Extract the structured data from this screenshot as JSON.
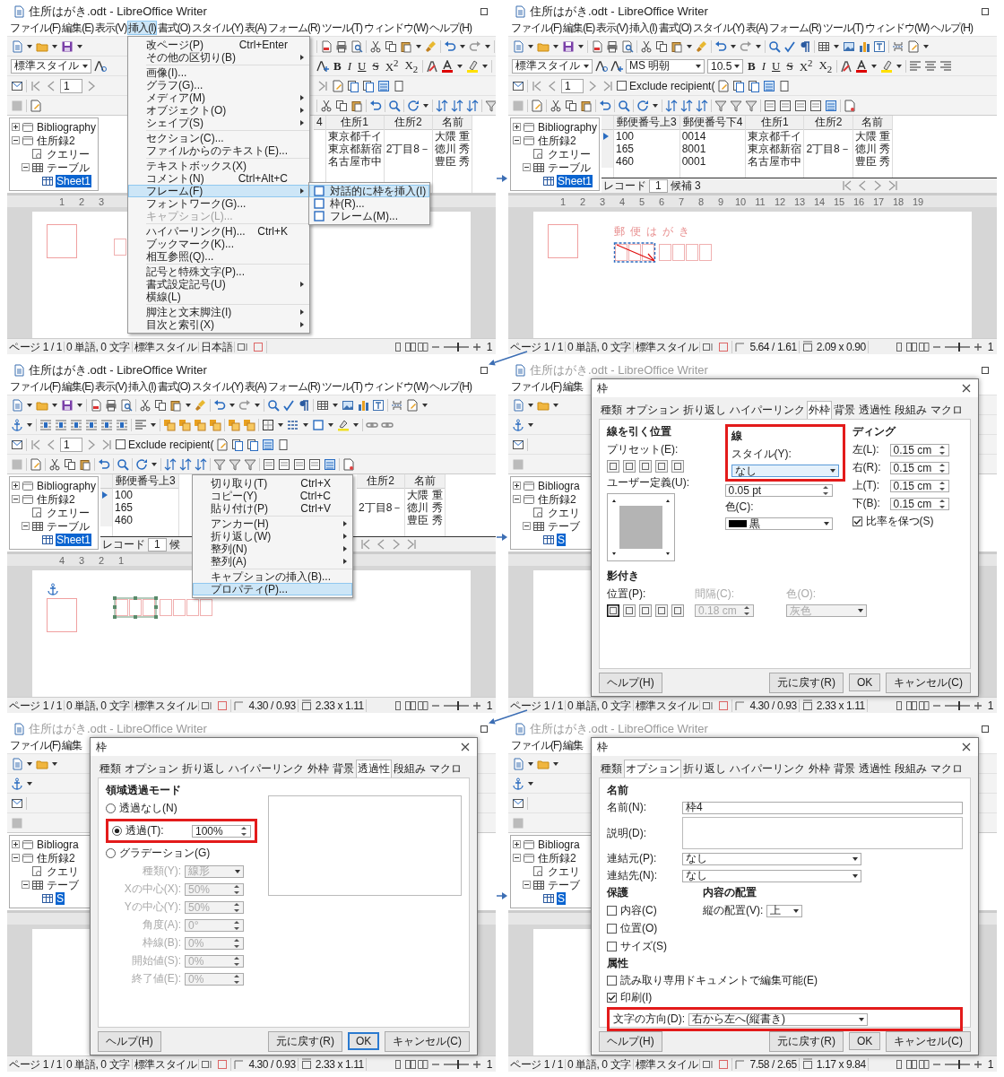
{
  "panels": [
    {
      "title": "住所はがき.odt - LibreOffice Writer",
      "active": true,
      "menu": [
        {
          "label": "ファイル(F)",
          "selected": false
        },
        {
          "label": "編集(E)",
          "selected": false
        },
        {
          "label": "表示(V)",
          "selected": false
        },
        {
          "label": "挿入(I)",
          "selected": true
        },
        {
          "label": "書式(O)",
          "selected": false
        },
        {
          "label": "スタイル(Y)",
          "selected": false
        },
        {
          "label": "表(A)",
          "selected": false
        },
        {
          "label": "フォーム(R)",
          "selected": false
        },
        {
          "label": "ツール(T)",
          "selected": false
        },
        {
          "label": "ウィンドウ(W)",
          "selected": false
        },
        {
          "label": "ヘルプ(H)",
          "selected": false
        }
      ],
      "toolbar": {
        "kind": "text"
      },
      "style_box": "標準スタイル",
      "format_buttons": [
        {
          "label": "B",
          "kind": "bold"
        },
        {
          "label": "I",
          "kind": "italic"
        },
        {
          "label": "U",
          "kind": "underline"
        },
        {
          "label": "S",
          "kind": "strike"
        },
        {
          "label": "X$^{2}$",
          "kind": "plain"
        },
        {
          "label": "X$_{2}$",
          "kind": "plain"
        }
      ],
      "page_field": "1",
      "tree": [
        {
          "label": "Bibliography",
          "kind": "database",
          "expanded": false,
          "selected": false
        },
        {
          "label": "住所録2",
          "kind": "database",
          "expanded": true,
          "selected": false,
          "children": [
            {
              "label": "クエリー",
              "kind": "queries",
              "selected": false
            },
            {
              "label": "テーブル",
              "kind": "tables",
              "expanded": true,
              "selected": false,
              "children": [
                {
                  "label": "Sheet1",
                  "kind": "table",
                  "selected": true
                }
              ]
            }
          ]
        }
      ],
      "table": {
        "columns": [
          "4",
          "住所1",
          "住所2",
          "名前"
        ],
        "rows": [
          {
            "cells": [
              null,
              "東京都千イ",
              null,
              "大隈 重"
            ]
          },
          {
            "cells": [
              null,
              "東京都新宿",
              "2丁目8－",
              "徳川 秀"
            ]
          },
          {
            "cells": [
              null,
              "名古屋市中",
              null,
              "豊臣 秀"
            ]
          }
        ]
      },
      "ruler": [
        "1",
        "2",
        "3"
      ],
      "document": {
        "kind": "plain"
      },
      "status": {
        "page": "ページ 1 / 1",
        "words": "0 単語, 0 文字",
        "style": "標準スタイル",
        "language": "日本語",
        "zoom": {
          "level": 0.55
        },
        "zoom_text": "1"
      },
      "overlay": {
        "kind": "menu",
        "groups": [
          [
            {
              "label": "改ページ(P)",
              "shortcut": "Ctrl+Enter",
              "submenu": false,
              "selected": false,
              "disabled": false
            },
            {
              "label": "その他の区切り(B)",
              "submenu": true,
              "selected": false,
              "disabled": false
            }
          ],
          [
            {
              "label": "画像(I)...",
              "submenu": false,
              "selected": false,
              "disabled": false
            },
            {
              "label": "グラフ(G)...",
              "submenu": false,
              "selected": false,
              "disabled": false
            },
            {
              "label": "メディア(M)",
              "submenu": true,
              "selected": false,
              "disabled": false
            },
            {
              "label": "オブジェクト(O)",
              "submenu": true,
              "selected": false,
              "disabled": false
            },
            {
              "label": "シェイプ(S)",
              "submenu": true,
              "selected": false,
              "disabled": false
            }
          ],
          [
            {
              "label": "セクション(C)...",
              "submenu": false,
              "selected": false,
              "disabled": false
            },
            {
              "label": "ファイルからのテキスト(E)...",
              "submenu": false,
              "selected": false,
              "disabled": false
            }
          ],
          [
            {
              "label": "テキストボックス(X)",
              "submenu": false,
              "selected": false,
              "disabled": false
            },
            {
              "label": "コメント(N)",
              "shortcut": "Ctrl+Alt+C",
              "submenu": false,
              "selected": false,
              "disabled": false
            },
            {
              "label": "フレーム(F)",
              "submenu": true,
              "selected": true,
              "disabled": false,
              "children": [
                {
                  "label": "対話的に枠を挿入(I)",
                  "selected": true
                },
                {
                  "label": "枠(R)...",
                  "selected": false
                },
                {
                  "label": "フレーム(M)...",
                  "selected": false
                }
              ]
            },
            {
              "label": "フォントワーク(G)...",
              "submenu": false,
              "selected": false,
              "disabled": false
            },
            {
              "label": "キャプション(L)...",
              "submenu": false,
              "selected": false,
              "disabled": true
            }
          ],
          [
            {
              "label": "ハイパーリンク(H)...",
              "shortcut": "Ctrl+K",
              "submenu": false,
              "selected": false,
              "disabled": false
            },
            {
              "label": "ブックマーク(K)...",
              "submenu": false,
              "selected": false,
              "disabled": false
            },
            {
              "label": "相互参照(Q)...",
              "submenu": false,
              "selected": false,
              "disabled": false
            }
          ],
          [
            {
              "label": "記号と特殊文字(P)...",
              "submenu": false,
              "selected": false,
              "disabled": false
            },
            {
              "label": "書式設定記号(U)",
              "submenu": true,
              "selected": false,
              "disabled": false
            },
            {
              "label": "横線(L)",
              "submenu": false,
              "selected": false,
              "disabled": false
            }
          ],
          [
            {
              "label": "脚注と文末脚注(I)",
              "submenu": true,
              "selected": false,
              "disabled": false
            },
            {
              "label": "目次と索引(X)",
              "submenu": true,
              "selected": false,
              "disabled": false
            }
          ]
        ]
      }
    },
    {
      "title": "住所はがき.odt - LibreOffice Writer",
      "active": true,
      "menu": [
        {
          "label": "ファイル(F)",
          "selected": false
        },
        {
          "label": "編集(E)",
          "selected": false
        },
        {
          "label": "表示(V)",
          "selected": false
        },
        {
          "label": "挿入(I)",
          "selected": false
        },
        {
          "label": "書式(O)",
          "selected": false
        },
        {
          "label": "スタイル(Y)",
          "selected": false
        },
        {
          "label": "表(A)",
          "selected": false
        },
        {
          "label": "フォーム(R)",
          "selected": false
        },
        {
          "label": "ツール(T)",
          "selected": false
        },
        {
          "label": "ウィンドウ(W)",
          "selected": false
        },
        {
          "label": "ヘルプ(H)",
          "selected": false
        }
      ],
      "toolbar": {
        "kind": "text"
      },
      "style_box": "標準スタイル",
      "font_box": "MS 明朝",
      "size_box": "10.5",
      "format_buttons": [
        {
          "label": "B",
          "kind": "bold"
        },
        {
          "label": "I",
          "kind": "italic"
        },
        {
          "label": "U",
          "kind": "underline"
        },
        {
          "label": "S",
          "kind": "strike"
        },
        {
          "label": "X$^{2}$",
          "kind": "plain"
        },
        {
          "label": "X$_{2}$",
          "kind": "plain"
        }
      ],
      "page_field": "1",
      "exclude": {
        "label": "Exclude recipient(",
        "checked": false
      },
      "tree": [
        {
          "label": "Bibliography",
          "kind": "database",
          "expanded": false,
          "selected": false
        },
        {
          "label": "住所録2",
          "kind": "database",
          "expanded": true,
          "selected": false,
          "children": [
            {
              "label": "クエリー",
              "kind": "queries",
              "selected": false
            },
            {
              "label": "テーブル",
              "kind": "tables",
              "expanded": true,
              "selected": false,
              "children": [
                {
                  "label": "Sheet1",
                  "kind": "table",
                  "selected": true
                }
              ]
            }
          ]
        }
      ],
      "table": {
        "columns": [
          "郵便番号上3",
          "郵便番号下4",
          "住所1",
          "住所2",
          "名前"
        ],
        "rows": [
          {
            "cells": [
              "100",
              "0014",
              "東京都千イ",
              null,
              "大隈 重"
            ],
            "current": true
          },
          {
            "cells": [
              "165",
              "8001",
              "東京都新宿",
              "2丁目8－",
              "徳川 秀"
            ],
            "current": false
          },
          {
            "cells": [
              "460",
              "0001",
              "名古屋市中",
              null,
              "豊臣 秀"
            ],
            "current": false
          }
        ],
        "record": {
          "label": "レコード",
          "value": "1",
          "count": "候補 3"
        }
      },
      "ruler": [
        "1",
        "2",
        "3",
        "4",
        "5",
        "6",
        "7",
        "8",
        "9",
        "10",
        "11",
        "12",
        "13",
        "14",
        "15",
        "16",
        "17",
        "18",
        "19"
      ],
      "document": {
        "kind": "drag",
        "heading": "郵便はがき"
      },
      "status": {
        "page": "ページ 1 / 1",
        "words": "0 単語, 0 文字",
        "style": "標準スタイル",
        "position": "5.64 / 1.61",
        "size": "2.09 x 0.90",
        "zoom": {
          "level": 0.55
        },
        "zoom_text": "1"
      }
    },
    {
      "title": "住所はがき.odt - LibreOffice Writer",
      "active": true,
      "menu": [
        {
          "label": "ファイル(F)",
          "selected": false
        },
        {
          "label": "編集(E)",
          "selected": false
        },
        {
          "label": "表示(V)",
          "selected": false
        },
        {
          "label": "挿入(I)",
          "selected": false
        },
        {
          "label": "書式(O)",
          "selected": false
        },
        {
          "label": "スタイル(Y)",
          "selected": false
        },
        {
          "label": "表(A)",
          "selected": false
        },
        {
          "label": "フォーム(R)",
          "selected": false
        },
        {
          "label": "ツール(T)",
          "selected": false
        },
        {
          "label": "ウィンドウ(W)",
          "selected": false
        },
        {
          "label": "ヘルプ(H)",
          "selected": false
        }
      ],
      "toolbar": {
        "kind": "frame"
      },
      "page_field": "1",
      "exclude": {
        "label": "Exclude recipient(",
        "checked": false
      },
      "tree": [
        {
          "label": "Bibliography",
          "kind": "database",
          "expanded": false,
          "selected": false
        },
        {
          "label": "住所録2",
          "kind": "database",
          "expanded": true,
          "selected": false,
          "children": [
            {
              "label": "クエリー",
              "kind": "queries",
              "selected": false
            },
            {
              "label": "テーブル",
              "kind": "tables",
              "expanded": true,
              "selected": false,
              "children": [
                {
                  "label": "Sheet1",
                  "kind": "table",
                  "selected": true
                }
              ]
            }
          ]
        }
      ],
      "table": {
        "columns": [
          "郵便番号上3",
          "住所2",
          "名前"
        ],
        "rows": [
          {
            "cells": [
              "100",
              null,
              "大隈 重"
            ],
            "current": true
          },
          {
            "cells": [
              "165",
              "2丁目8－",
              "徳川 秀"
            ],
            "current": false
          },
          {
            "cells": [
              "460",
              null,
              "豊臣 秀"
            ],
            "current": false
          }
        ],
        "record": {
          "label": "レコード",
          "value": "1",
          "count": "候"
        }
      },
      "ruler": [
        "4",
        "3",
        "2",
        "1"
      ],
      "document": {
        "kind": "selected"
      },
      "status": {
        "page": "ページ 1 / 1",
        "words": "0 単語, 0 文字",
        "style": "標準スタイル",
        "position": "4.30 / 0.93",
        "size": "2.33 x 1.11",
        "zoom": {
          "level": 0.55
        },
        "zoom_text": "1"
      },
      "overlay": {
        "kind": "context_menu",
        "groups": [
          [
            {
              "label": "切り取り(T)",
              "shortcut": "Ctrl+X",
              "submenu": false,
              "selected": false,
              "disabled": false
            },
            {
              "label": "コピー(Y)",
              "shortcut": "Ctrl+C",
              "submenu": false,
              "selected": false,
              "disabled": false
            },
            {
              "label": "貼り付け(P)",
              "shortcut": "Ctrl+V",
              "submenu": false,
              "selected": false,
              "disabled": false
            }
          ],
          [
            {
              "label": "アンカー(H)",
              "submenu": true,
              "selected": false,
              "disabled": false
            },
            {
              "label": "折り返し(W)",
              "submenu": true,
              "selected": false,
              "disabled": false
            },
            {
              "label": "整列(N)",
              "submenu": true,
              "selected": false,
              "disabled": false
            },
            {
              "label": "整列(A)",
              "submenu": true,
              "selected": false,
              "disabled": false
            }
          ],
          [
            {
              "label": "キャプションの挿入(B)...",
              "submenu": false,
              "selected": false,
              "disabled": false
            },
            {
              "label": "プロパティ(P)...",
              "submenu": false,
              "selected": true,
              "disabled": false
            }
          ]
        ]
      }
    },
    {
      "title": "住所はがき.odt - LibreOffice Writer",
      "active": false,
      "menu": [
        {
          "label": "ファイル(F)",
          "selected": false
        },
        {
          "label": "編集",
          "selected": false
        }
      ],
      "toolbar": {
        "kind": "frame"
      },
      "tree": [
        {
          "label": "Bibliogra",
          "kind": "database",
          "expanded": false,
          "selected": false
        },
        {
          "label": "住所録2",
          "kind": "database",
          "expanded": true,
          "selected": false,
          "children": [
            {
              "label": "クエリ",
              "kind": "queries",
              "selected": false
            },
            {
              "label": "テーブ",
              "kind": "tables",
              "expanded": true,
              "selected": false,
              "children": [
                {
                  "label": "S",
                  "kind": "table",
                  "selected": true
                }
              ]
            }
          ]
        }
      ],
      "document": {
        "kind": "covered"
      },
      "status": {
        "page": "ページ 1 / 1",
        "words": "0 単語, 0 文字",
        "style": "標準スタイル",
        "position": "4.30 / 0.93",
        "size": "2.33 x 1.11",
        "zoom": {
          "level": 0.55
        },
        "zoom_text": "1"
      },
      "overlay": {
        "kind": "dialog",
        "title": "枠",
        "tabs": [
          {
            "label": "種類",
            "selected": false
          },
          {
            "label": "オプション",
            "selected": false
          },
          {
            "label": "折り返し",
            "selected": false
          },
          {
            "label": "ハイパーリンク",
            "selected": false
          },
          {
            "label": "外枠",
            "selected": true
          },
          {
            "label": "背景",
            "selected": false
          },
          {
            "label": "透過性",
            "selected": false
          },
          {
            "label": "段組み",
            "selected": false
          },
          {
            "label": "マクロ",
            "selected": false
          }
        ],
        "content": {
          "kind": "borders",
          "arrangement": {
            "heading": "線を引く位置",
            "preset_label": "プリセット(E):",
            "user_label": "ユーザー定義(U):"
          },
          "line": {
            "heading": "線",
            "style_label": "スタイル(Y):",
            "style_value": "なし",
            "highlighted": true,
            "width_value": "0.05 pt",
            "color_label": "色(C):",
            "color_value": "黒"
          },
          "padding": {
            "heading": "ディング",
            "fields": [
              {
                "label": "左(L):",
                "value": "0.15 cm"
              },
              {
                "label": "右(R):",
                "value": "0.15 cm"
              },
              {
                "label": "上(T):",
                "value": "0.15 cm"
              },
              {
                "label": "下(B):",
                "value": "0.15 cm"
              }
            ],
            "keep_ratio": {
              "label": "比率を保つ(S)",
              "checked": true
            }
          },
          "shadow": {
            "heading": "影付き",
            "position_label": "位置(P):",
            "positions": [
              {
                "selected": true
              },
              {
                "selected": false
              },
              {
                "selected": false
              },
              {
                "selected": false
              },
              {
                "selected": false
              }
            ],
            "distance_label": "間隔(C):",
            "distance_value": "0.18 cm",
            "color_label": "色(O):",
            "color_value": "灰色",
            "disabled": true
          }
        },
        "buttons": [
          {
            "label": "ヘルプ(H)",
            "focused": false
          },
          {
            "label": "元に戻す(R)",
            "focused": false
          },
          {
            "label": "OK",
            "focused": false
          },
          {
            "label": "キャンセル(C)",
            "focused": false
          }
        ]
      }
    },
    {
      "title": "住所はがき.odt - LibreOffice Writer",
      "active": false,
      "menu": [
        {
          "label": "ファイル(F)",
          "selected": false
        },
        {
          "label": "編集",
          "selected": false
        }
      ],
      "toolbar": {
        "kind": "frame"
      },
      "tree": [
        {
          "label": "Bibliogra",
          "kind": "database",
          "expanded": false,
          "selected": false
        },
        {
          "label": "住所録2",
          "kind": "database",
          "expanded": true,
          "selected": false,
          "children": [
            {
              "label": "クエリ",
              "kind": "queries",
              "selected": false
            },
            {
              "label": "テーブ",
              "kind": "tables",
              "expanded": true,
              "selected": false,
              "children": [
                {
                  "label": "S",
                  "kind": "table",
                  "selected": true
                }
              ]
            }
          ]
        }
      ],
      "document": {
        "kind": "covered"
      },
      "status": {
        "page": "ページ 1 / 1",
        "words": "0 単語, 0 文字",
        "style": "標準スタイル",
        "position": "4.30 / 0.93",
        "size": "2.33 x 1.11",
        "zoom": {
          "level": 0.55
        },
        "zoom_text": "1"
      },
      "overlay": {
        "kind": "dialog",
        "title": "枠",
        "tabs": [
          {
            "label": "種類",
            "selected": false
          },
          {
            "label": "オプション",
            "selected": false
          },
          {
            "label": "折り返し",
            "selected": false
          },
          {
            "label": "ハイパーリンク",
            "selected": false
          },
          {
            "label": "外枠",
            "selected": false
          },
          {
            "label": "背景",
            "selected": false
          },
          {
            "label": "透過性",
            "selected": true
          },
          {
            "label": "段組み",
            "selected": false
          },
          {
            "label": "マクロ",
            "selected": false
          }
        ],
        "content": {
          "kind": "transparency",
          "heading": "領域透過モード",
          "options": [
            {
              "label": "透過なし(N)",
              "selected": false,
              "highlighted": false
            },
            {
              "label": "透過(T):",
              "selected": true,
              "highlighted": true,
              "value": "100%"
            },
            {
              "label": "グラデーション(G)",
              "selected": false,
              "highlighted": false
            }
          ],
          "gradient_disabled": true,
          "gradient_fields": [
            {
              "label": "種類(Y):",
              "value": "線形",
              "kind": "dropdown"
            },
            {
              "label": "Xの中心(X):",
              "value": "50%",
              "kind": "spin"
            },
            {
              "label": "Yの中心(Y):",
              "value": "50%",
              "kind": "spin"
            },
            {
              "label": "角度(A):",
              "value": "0°",
              "kind": "spin"
            },
            {
              "label": "枠線(B):",
              "value": "0%",
              "kind": "spin"
            },
            {
              "label": "開始値(S):",
              "value": "0%",
              "kind": "spin"
            },
            {
              "label": "終了値(E):",
              "value": "0%",
              "kind": "spin"
            }
          ]
        },
        "buttons": [
          {
            "label": "ヘルプ(H)",
            "focused": false
          },
          {
            "label": "元に戻す(R)",
            "focused": false
          },
          {
            "label": "OK",
            "focused": true
          },
          {
            "label": "キャンセル(C)",
            "focused": false
          }
        ]
      }
    },
    {
      "title": "住所はがき.odt - LibreOffice Writer",
      "active": false,
      "menu": [
        {
          "label": "ファイル(F)",
          "selected": false
        },
        {
          "label": "編集",
          "selected": false
        }
      ],
      "toolbar": {
        "kind": "frame"
      },
      "tree": [
        {
          "label": "Bibliogra",
          "kind": "database",
          "expanded": false,
          "selected": false
        },
        {
          "label": "住所録2",
          "kind": "database",
          "expanded": true,
          "selected": false,
          "children": [
            {
              "label": "クエリ",
              "kind": "queries",
              "selected": false
            },
            {
              "label": "テーブ",
              "kind": "tables",
              "expanded": true,
              "selected": false,
              "children": [
                {
                  "label": "S",
                  "kind": "table",
                  "selected": true
                }
              ]
            }
          ]
        }
      ],
      "document": {
        "kind": "covered"
      },
      "status": {
        "page": "ページ 1 / 1",
        "words": "0 単語, 0 文字",
        "style": "標準スタイル",
        "position": "7.58 / 2.65",
        "size": "1.17 x 9.84",
        "zoom": {
          "level": 0.55
        },
        "zoom_text": "1"
      },
      "overlay": {
        "kind": "dialog",
        "title": "枠",
        "tabs": [
          {
            "label": "種類",
            "selected": false
          },
          {
            "label": "オプション",
            "selected": true
          },
          {
            "label": "折り返し",
            "selected": false
          },
          {
            "label": "ハイパーリンク",
            "selected": false
          },
          {
            "label": "外枠",
            "selected": false
          },
          {
            "label": "背景",
            "selected": false
          },
          {
            "label": "透過性",
            "selected": false
          },
          {
            "label": "段組み",
            "selected": false
          },
          {
            "label": "マクロ",
            "selected": false
          }
        ],
        "content": {
          "kind": "options",
          "name_heading": "名前",
          "name_label": "名前(N):",
          "name_value": "枠4",
          "description_label": "説明(D):",
          "prev_label": "連結元(P):",
          "prev_value": "なし",
          "next_label": "連結先(N):",
          "next_value": "なし",
          "protect_heading": "保護",
          "protect": [
            {
              "label": "内容(C)",
              "checked": false
            },
            {
              "label": "位置(O)",
              "checked": false
            },
            {
              "label": "サイズ(S)",
              "checked": false
            }
          ],
          "position_heading": "内容の配置",
          "vertical_label": "縦の配置(V):",
          "vertical_value": "上",
          "props_heading": "属性",
          "props": [
            {
              "label": "読み取り専用ドキュメントで編集可能(E)",
              "checked": false
            },
            {
              "label": "印刷(I)",
              "checked": true
            }
          ],
          "direction": {
            "label": "文字の方向(D):",
            "value": "右から左へ(縦書き)",
            "highlighted": true
          }
        },
        "buttons": [
          {
            "label": "ヘルプ(H)",
            "focused": false
          },
          {
            "label": "元に戻す(R)",
            "focused": false
          },
          {
            "label": "OK",
            "focused": false
          },
          {
            "label": "キャンセル(C)",
            "focused": false
          }
        ]
      }
    }
  ]
}
